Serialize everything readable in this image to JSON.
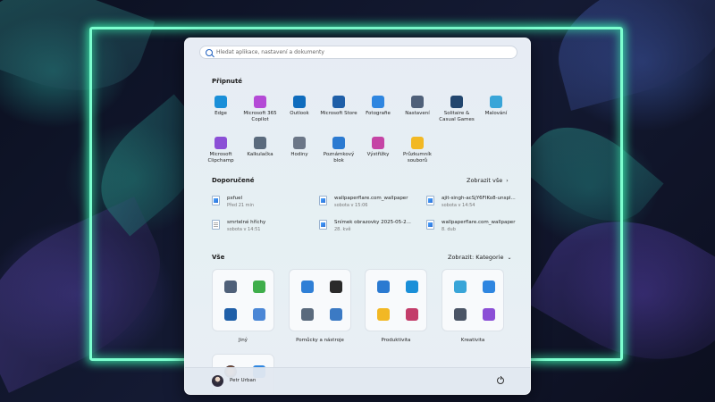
{
  "search": {
    "placeholder": "Hledat aplikace, nastavení a dokumenty"
  },
  "pinned": {
    "title": "Připnuté",
    "apps": [
      {
        "label": "Edge",
        "icon": "edge-icon",
        "color": "#1a8fd8"
      },
      {
        "label": "Microsoft 365 Copilot",
        "icon": "copilot-icon",
        "color": "#b44ad6"
      },
      {
        "label": "Outlook",
        "icon": "outlook-icon",
        "color": "#0f6cbd"
      },
      {
        "label": "Microsoft Store",
        "icon": "store-icon",
        "color": "#1f5fa8"
      },
      {
        "label": "Fotografie",
        "icon": "photos-icon",
        "color": "#2f86e0"
      },
      {
        "label": "Nastavení",
        "icon": "settings-icon",
        "color": "#4f6079"
      },
      {
        "label": "Solitaire & Casual Games",
        "icon": "solitaire-icon",
        "color": "#22466e"
      },
      {
        "label": "Malování",
        "icon": "paint-icon",
        "color": "#39a5d8"
      },
      {
        "label": "Microsoft Clipchamp",
        "icon": "clipchamp-icon",
        "color": "#8b4fd6"
      },
      {
        "label": "Kalkulačka",
        "icon": "calculator-icon",
        "color": "#5a6a7d"
      },
      {
        "label": "Hodiny",
        "icon": "clock-icon",
        "color": "#6b7687"
      },
      {
        "label": "Poznámkový blok",
        "icon": "notepad-icon",
        "color": "#2b7ad1"
      },
      {
        "label": "Výstřižky",
        "icon": "snipping-icon",
        "color": "#c544a5"
      },
      {
        "label": "Průzkumník souborů",
        "icon": "folder-icon",
        "color": "#f2b824"
      }
    ]
  },
  "recommended": {
    "title": "Doporučené",
    "more_label": "Zobrazit vše",
    "items": [
      {
        "name": "pxfuel",
        "sub": "Před 21 min",
        "type": "img"
      },
      {
        "name": "wallpaperflare.com_wallpaper",
        "sub": "sobota v 15:06",
        "type": "img"
      },
      {
        "name": "ajit-singh-acSjY6FIKo8-unspl...",
        "sub": "sobota v 14:54",
        "type": "img"
      },
      {
        "name": "smrtelné hříchy",
        "sub": "sobota v 14:51",
        "type": "doc"
      },
      {
        "name": "Snímek obrazovky 2025-05-2...",
        "sub": "28. kvě",
        "type": "img"
      },
      {
        "name": "wallpaperflare.com_wallpaper",
        "sub": "8. dub",
        "type": "img"
      }
    ]
  },
  "all": {
    "title": "Vše",
    "view_label": "Zobrazit: Kategorie",
    "folders": [
      {
        "label": "Jiný",
        "colors": [
          "#4f6079",
          "#3fae4b",
          "#1f5fa8",
          "#4b87d6"
        ]
      },
      {
        "label": "Pomůcky a nástroje",
        "colors": [
          "#2f7fd6",
          "#2a2a2a",
          "#5a6a7d",
          "#3b7ac4"
        ]
      },
      {
        "label": "Produktivita",
        "colors": [
          "#2b7ad1",
          "#1a8fd8",
          "#f2b824",
          "#c33d6a"
        ]
      },
      {
        "label": "Kreativita",
        "colors": [
          "#39a5d8",
          "#2f86e0",
          "#4b5566",
          "#8b4fd6"
        ]
      }
    ]
  },
  "user": {
    "name": "Petr Urban"
  }
}
